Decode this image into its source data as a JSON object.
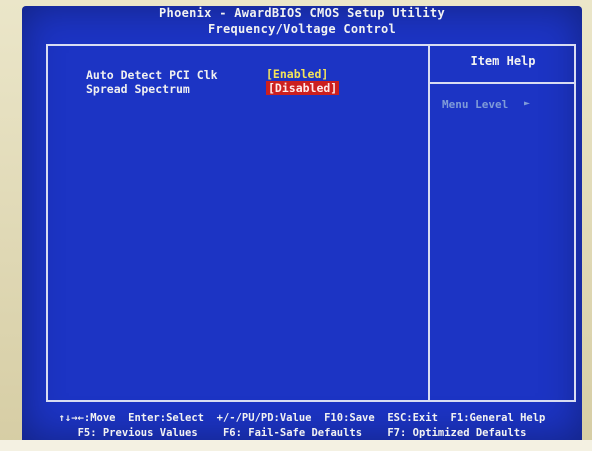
{
  "header": {
    "title": "Phoenix - AwardBIOS CMOS Setup Utility",
    "subtitle": "Frequency/Voltage Control"
  },
  "settings": [
    {
      "label": "Auto Detect PCI Clk",
      "value": "[Enabled]",
      "selected": false,
      "value_color": "#f3e35a"
    },
    {
      "label": "Spread Spectrum",
      "value": "[Disabled]",
      "selected": true,
      "highlight_color": "#cc1f1f"
    }
  ],
  "help_panel": {
    "title": "Item Help",
    "menu_level_label": "Menu Level",
    "menu_level_icon": "right-arrow-icon"
  },
  "footer": {
    "line1": "↑↓→←:Move  Enter:Select  +/-/PU/PD:Value  F10:Save  ESC:Exit  F1:General Help",
    "line2": "F5: Previous Values    F6: Fail-Safe Defaults    F7: Optimized Defaults"
  },
  "colors": {
    "screen_background": "#1c34c4",
    "text": "#f0f0f0",
    "menu_level_text": "#7f9bd8"
  }
}
